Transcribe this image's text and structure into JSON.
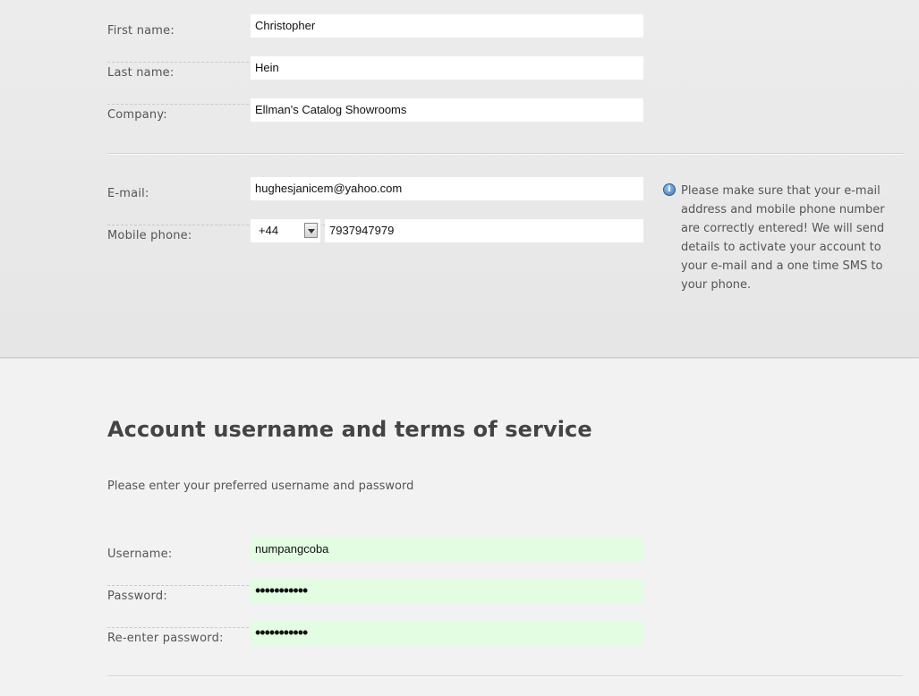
{
  "contact": {
    "first_name": {
      "label": "First name:",
      "value": "Christopher"
    },
    "last_name": {
      "label": "Last name:",
      "value": "Hein"
    },
    "company": {
      "label": "Company:",
      "value": "Ellman's Catalog Showrooms"
    },
    "email": {
      "label": "E-mail:",
      "value": "hughesjanicem@yahoo.com"
    },
    "mobile": {
      "label": "Mobile phone:",
      "prefix": "+44",
      "value": "7937947979"
    },
    "info_icon": "info-icon",
    "info_text": "Please make sure that your e-mail address and mobile phone number are correctly entered! We will send details to activate your account to your e-mail and a one time SMS to your phone."
  },
  "account": {
    "heading": "Account username and terms of service",
    "subtext": "Please enter your preferred username and password",
    "username": {
      "label": "Username:",
      "value": "numpangcoba"
    },
    "password": {
      "label": "Password:",
      "value": "•••••••••••"
    },
    "reenter_password": {
      "label": "Re-enter password:",
      "value": "•••••••••••"
    }
  },
  "colors": {
    "valid_field": "#e2fde2",
    "page_bg": "#f2f2f2"
  }
}
